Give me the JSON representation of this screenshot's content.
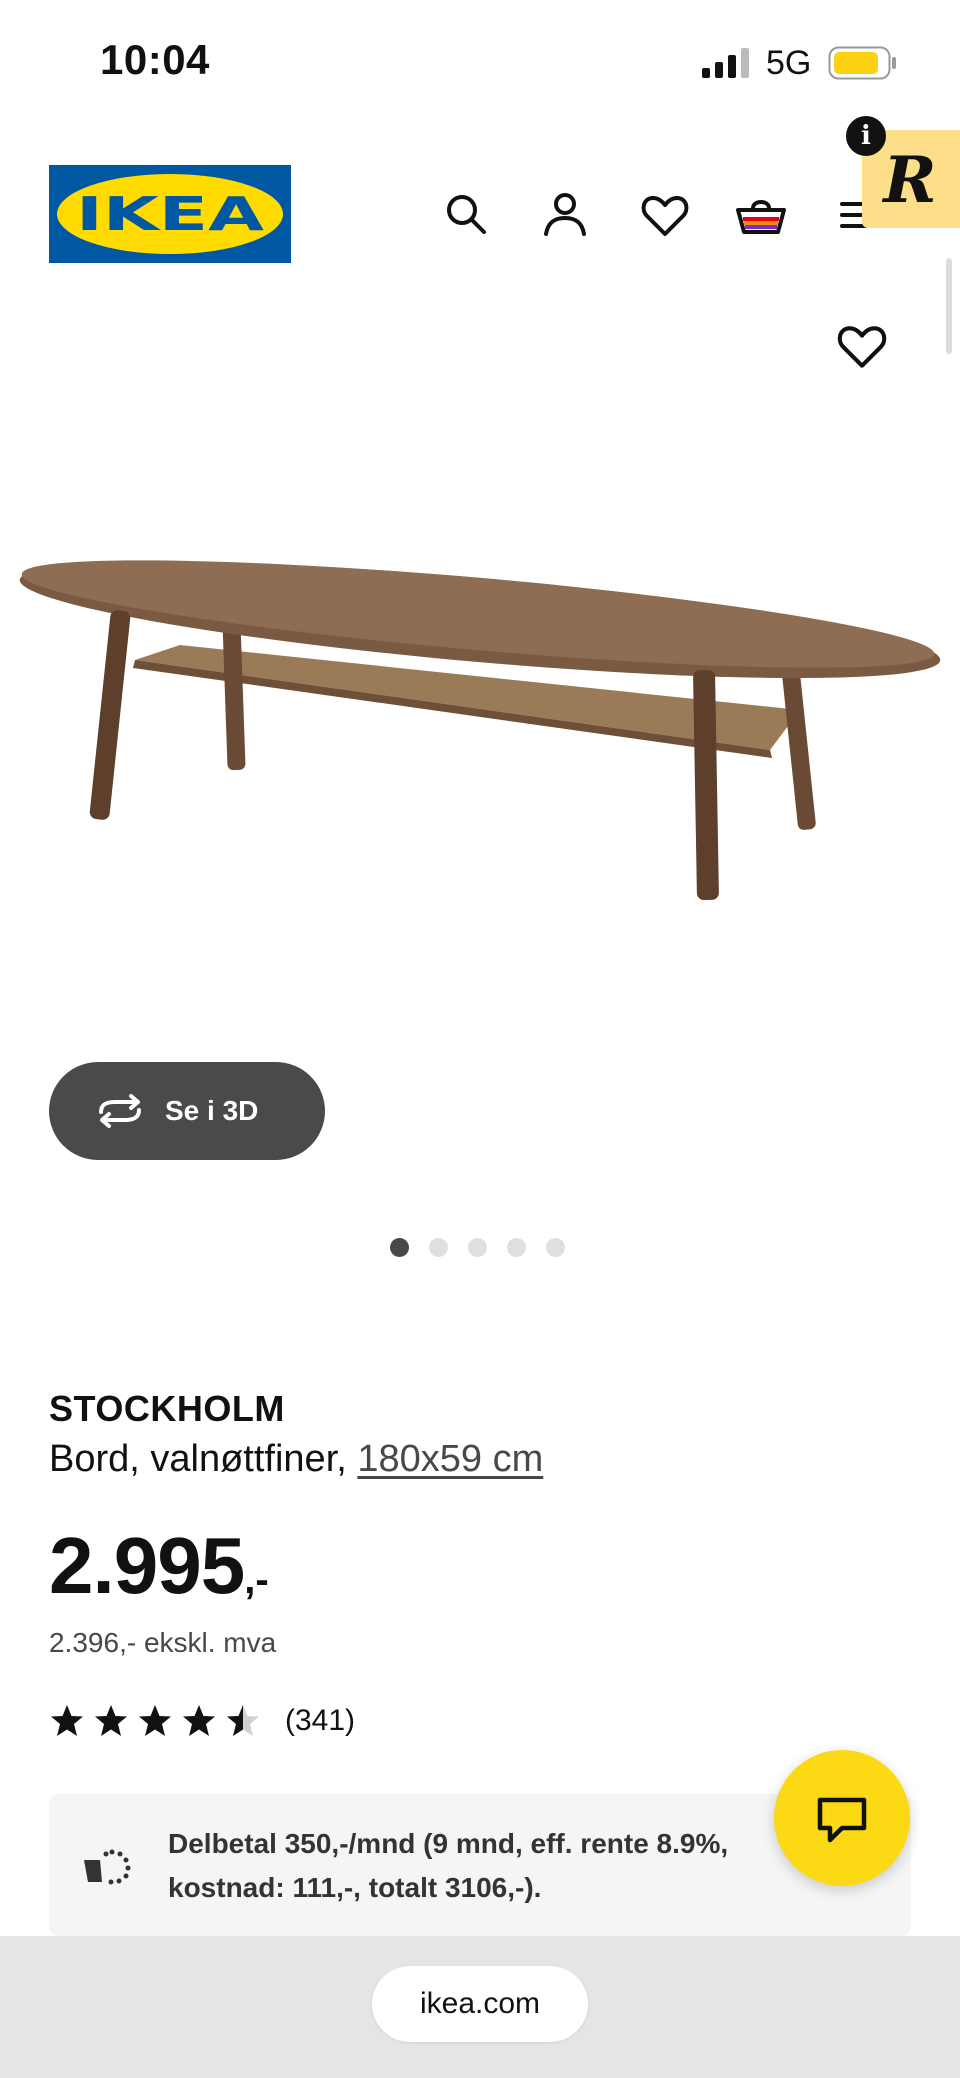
{
  "status_bar": {
    "time": "10:04",
    "network": "5G",
    "battery_color": "#fcd213"
  },
  "header": {
    "logo_text": "IKEA",
    "brand_colors": {
      "blue": "#0058a3",
      "yellow": "#ffdb00"
    },
    "icons": [
      "search-icon",
      "account-icon",
      "heart-icon",
      "cart-icon",
      "menu-icon"
    ]
  },
  "overlay": {
    "info_glyph": "i",
    "badge_glyph": "R"
  },
  "gallery": {
    "button_3d_label": "Se i 3D",
    "dot_count": 5,
    "active_dot": 0
  },
  "product": {
    "name": "STOCKHOLM",
    "description": "Bord, valnøttfiner, ",
    "size_link": "180x59 cm",
    "price_amount": "2.995",
    "price_suffix": ",-",
    "price_excl_vat": "2.396,- ekskl. mva",
    "rating_value": 4.5,
    "rating_count": "(341)"
  },
  "financing": {
    "text": "Delbetal 350,-/mnd (9 mnd, eff. rente 8.9%, kostnad: 111,-, totalt 3106,-)."
  },
  "chat": {
    "color": "#fbd914"
  },
  "browser": {
    "url": "ikea.com"
  }
}
